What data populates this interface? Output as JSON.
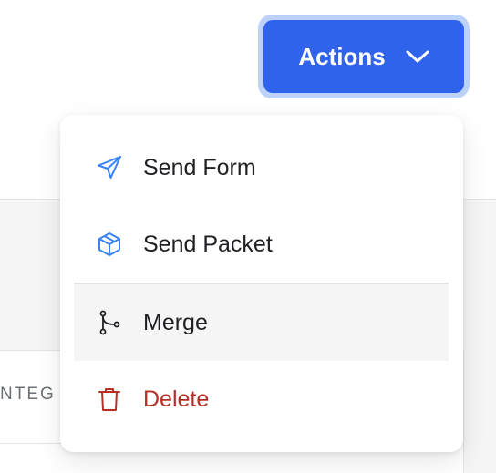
{
  "actions": {
    "label": "Actions",
    "chevron_icon": "chevron-down-icon"
  },
  "background": {
    "column_header_label": "NTEG"
  },
  "menu": {
    "items": [
      {
        "label": "Send Form",
        "icon": "send-icon",
        "color": "#1f2023",
        "icon_color": "#3b82f6"
      },
      {
        "label": "Send Packet",
        "icon": "package-icon",
        "color": "#1f2023",
        "icon_color": "#3b82f6"
      },
      {
        "label": "Merge",
        "icon": "merge-icon",
        "color": "#1f2023",
        "icon_color": "#1f2023",
        "highlighted": true
      },
      {
        "label": "Delete",
        "icon": "trash-icon",
        "color": "#b52f25",
        "icon_color": "#b52f25"
      }
    ]
  },
  "colors": {
    "accent": "#2f63eb",
    "focus_ring": "#bcd2fb",
    "danger": "#b52f25"
  }
}
